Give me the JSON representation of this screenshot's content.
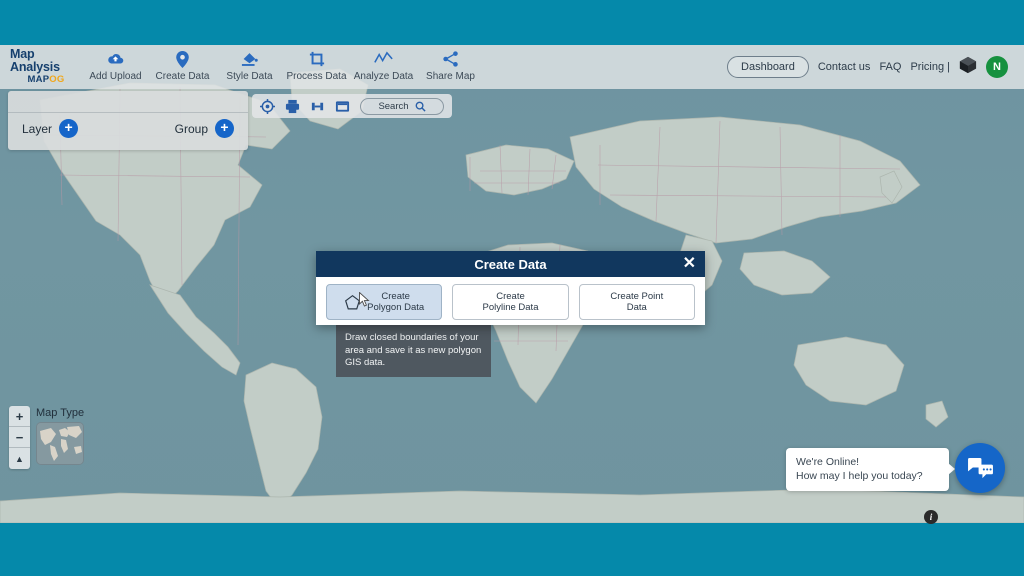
{
  "app": {
    "brand_title": "Map Analysis",
    "brand_sub_main": "MAP",
    "brand_sub_accent": "OG",
    "background_color": "#0589aa",
    "accent_color": "#1565c9",
    "modal_header_color": "#11375e"
  },
  "topnav": {
    "items": [
      {
        "label": "Add Upload",
        "icon": "cloud-upload-icon"
      },
      {
        "label": "Create Data",
        "icon": "map-pin-icon"
      },
      {
        "label": "Style Data",
        "icon": "paint-bucket-icon"
      },
      {
        "label": "Process Data",
        "icon": "crop-transform-icon"
      },
      {
        "label": "Analyze Data",
        "icon": "trend-chart-icon"
      },
      {
        "label": "Share Map",
        "icon": "share-nodes-icon"
      }
    ],
    "dashboard_label": "Dashboard",
    "contact_label": "Contact us",
    "faq_label": "FAQ",
    "pricing_label": "Pricing |",
    "cube_icon": "3d-cube-icon",
    "avatar_initial": "N",
    "avatar_color": "#16913f"
  },
  "layer_panel": {
    "layer_label": "Layer",
    "group_label": "Group",
    "plus_glyph": "+"
  },
  "map_toolbar": {
    "icons": [
      "locate-target-icon",
      "print-icon",
      "measure-icon",
      "legend-panel-icon"
    ],
    "search_placeholder": "Search",
    "search_value": "Search",
    "search_icon": "search-icon"
  },
  "map_controls": {
    "zoom_in": "+",
    "zoom_out": "−",
    "compass": "▲",
    "map_type_label": "Map Type"
  },
  "modal": {
    "title": "Create Data",
    "close_glyph": "✕",
    "options": [
      {
        "label_line1": "Create",
        "label_line2": "Polygon Data",
        "icon": "pentagon-icon",
        "active": true
      },
      {
        "label_line1": "Create",
        "label_line2": "Polyline Data",
        "icon": "polyline-icon",
        "active": false
      },
      {
        "label_line1": "Create Point",
        "label_line2": "Data",
        "icon": "point-icon",
        "active": false
      }
    ]
  },
  "tooltip": {
    "text": "Draw closed boundaries of your area and save it as new polygon GIS data."
  },
  "chat": {
    "line1": "We're Online!",
    "line2": "How may I help you today?",
    "launcher_icon": "chat-bubbles-icon",
    "launcher_color": "#1566c8"
  },
  "info": {
    "glyph": "i"
  }
}
